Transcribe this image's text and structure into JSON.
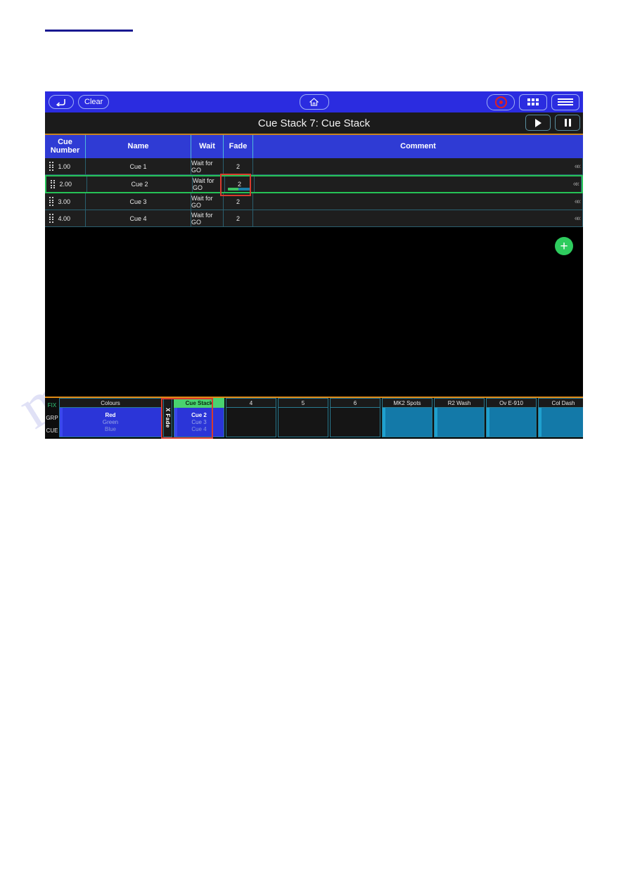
{
  "document": {
    "watermark": "manualshive.com"
  },
  "toolbar": {
    "back_label": "↩",
    "back_icon": "back-arrow-icon",
    "clear_label": "Clear",
    "home_icon": "home-icon",
    "record_icon": "record-icon",
    "grid_icon": "grid-icon",
    "menu_icon": "hamburger-menu-icon"
  },
  "titlebar": {
    "title": "Cue Stack 7: Cue Stack",
    "play_icon": "play-icon",
    "pause_icon": "pause-icon"
  },
  "table": {
    "headers": {
      "cue_number": "Cue\nNumber",
      "cue_number_line1": "Cue",
      "cue_number_line2": "Number",
      "name": "Name",
      "wait": "Wait",
      "fade": "Fade",
      "comment": "Comment"
    },
    "rows": [
      {
        "cue_number": "1.00",
        "name": "Cue 1",
        "wait": "Wait for GO",
        "fade": "2",
        "comment": "",
        "selected": false,
        "progress_green_pct": 0
      },
      {
        "cue_number": "2.00",
        "name": "Cue 2",
        "wait": "Wait for GO",
        "fade": "2",
        "comment": "",
        "selected": true,
        "progress_green_pct": 45
      },
      {
        "cue_number": "3.00",
        "name": "Cue 3",
        "wait": "Wait for GO",
        "fade": "2",
        "comment": "",
        "selected": false,
        "progress_green_pct": 0
      },
      {
        "cue_number": "4.00",
        "name": "Cue 4",
        "wait": "Wait for GO",
        "fade": "2",
        "comment": "",
        "selected": false,
        "progress_green_pct": 0
      }
    ],
    "row_collapse_icon": "double-chevron-left-icon"
  },
  "canvas": {
    "add_label": "+"
  },
  "playback_bar": {
    "side_labels": {
      "fix": "FIX",
      "grp": "GRP",
      "cue": "CUE"
    },
    "xfade_label": "X Fade",
    "faders": [
      {
        "title": "Colours",
        "lines": [
          "Red",
          "Green",
          "Blue"
        ],
        "style": "blue",
        "wide": true,
        "highlighted": false
      },
      {
        "title": "Cue Stack",
        "lines": [
          "Cue 2",
          "Cue 3",
          "Cue 4"
        ],
        "style": "blue",
        "wide": false,
        "highlighted": true
      },
      {
        "title": "4",
        "lines": [],
        "style": "empty",
        "wide": false,
        "highlighted": false
      },
      {
        "title": "5",
        "lines": [],
        "style": "empty",
        "wide": false,
        "highlighted": false
      },
      {
        "title": "6",
        "lines": [],
        "style": "empty",
        "wide": false,
        "highlighted": false
      },
      {
        "title": "MK2 Spots",
        "lines": [],
        "style": "teal",
        "wide": false,
        "highlighted": false
      },
      {
        "title": "R2 Wash",
        "lines": [],
        "style": "teal",
        "wide": false,
        "highlighted": false
      },
      {
        "title": "Ov E-910",
        "lines": [],
        "style": "teal",
        "wide": false,
        "highlighted": false
      },
      {
        "title": "Col Dash",
        "lines": [],
        "style": "teal",
        "wide": false,
        "highlighted": false
      }
    ]
  },
  "colors": {
    "toolbar_blue": "#2b2ce0",
    "header_blue": "#2f3bd4",
    "accent_orange": "#e08a16",
    "select_green": "#26c256",
    "alert_red": "#d73b2e",
    "teal_border": "#2a7c92",
    "fab_green": "#2ecc5e"
  }
}
